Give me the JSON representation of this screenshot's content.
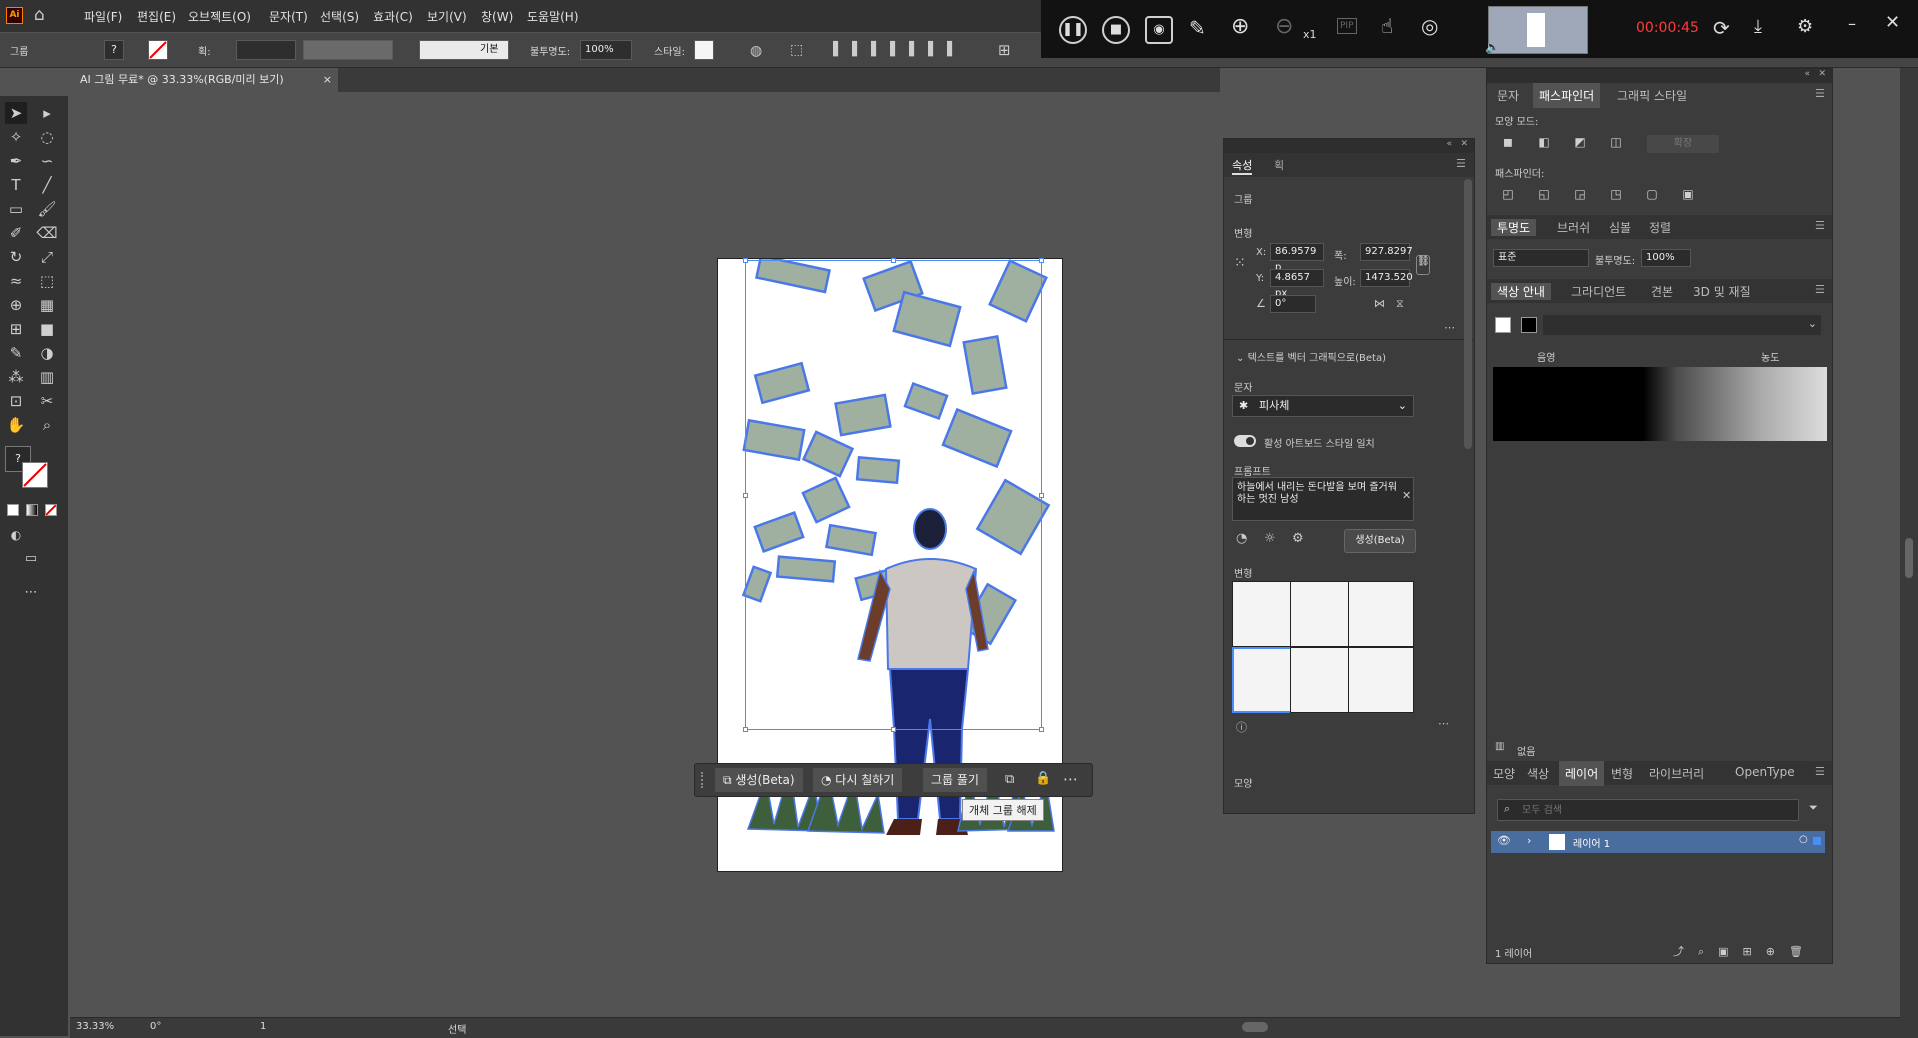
{
  "app": {
    "logo": "Ai",
    "menus": [
      "파일(F)",
      "편집(E)",
      "오브젝트(O)",
      "문자(T)",
      "선택(S)",
      "효과(C)",
      "보기(V)",
      "창(W)",
      "도움말(H)"
    ]
  },
  "control": {
    "group_label": "그룹",
    "stroke_label": "획:",
    "style_value": "기본",
    "opacity_label": "불투명도:",
    "opacity_value": "100%",
    "style_label": "스타일:"
  },
  "recorder": {
    "time": "00:00:45",
    "zoom": "x1",
    "pip": "PIP"
  },
  "document": {
    "tab_title": "AI 그림 무료* @ 33.33%(RGB/미리 보기)",
    "close": "×"
  },
  "context": {
    "generate": "생성(Beta)",
    "recolor": "다시 칠하기",
    "ungroup": "그룹 풀기",
    "tooltip": "개체 그룹 해제"
  },
  "properties": {
    "tabs": [
      "속성",
      "획"
    ],
    "group": "그룹",
    "transform": "변형",
    "x_label": "X:",
    "x_value": "86.9579 p",
    "y_label": "Y:",
    "y_value": "4.8657 px",
    "w_label": "폭:",
    "w_value": "927.8297",
    "h_label": "높이:",
    "h_value": "1473.520",
    "angle_value": "0°",
    "section": "텍스트를 벡터 그래픽으로(Beta)",
    "subject_label": "문자",
    "subject_value": "피사체",
    "toggle_label": "활성 아트보드 스타일 일치",
    "prompt_label": "프롬프트",
    "prompt_text": "하늘에서 내리는 돈다발을 보며 즐거워하는 멋진 남성",
    "generate": "생성(Beta)",
    "variations": "변형",
    "appearance": "모양"
  },
  "right": {
    "tabs_top": [
      "문자",
      "패스파인더",
      "그래픽 스타일"
    ],
    "shape_modes": "모양 모드:",
    "expand": "확장",
    "pathfinders": "패스파인더:",
    "tabs_transp": [
      "투명도",
      "브러쉬",
      "심볼",
      "정렬"
    ],
    "blend_mode": "표준",
    "opacity_label": "불투명도:",
    "opacity_value": "100%",
    "tabs_color": [
      "색상 안내",
      "그라디언트",
      "견본",
      "3D 및 재질"
    ],
    "shade_label": "음영",
    "tint_label": "농도",
    "none_label": "없음",
    "tabs_layers": [
      "모양",
      "색상",
      "레이어",
      "변형",
      "라이브러리",
      "OpenType"
    ],
    "search_placeholder": "모두 검색",
    "layer_name": "레이어 1",
    "layer_count": "1 레이어"
  },
  "status": {
    "zoom": "33.33%",
    "angle": "0°",
    "page": "1",
    "tool": "선택"
  },
  "colors": {
    "accent": "#4b8df8",
    "swatch_row": [
      "#000000",
      "#1b1b1b",
      "#222222",
      "#2b2b2b",
      "#333333",
      "#5a5a5a",
      "#8a8a8a",
      "#b5b5b5",
      "#dedede"
    ]
  }
}
